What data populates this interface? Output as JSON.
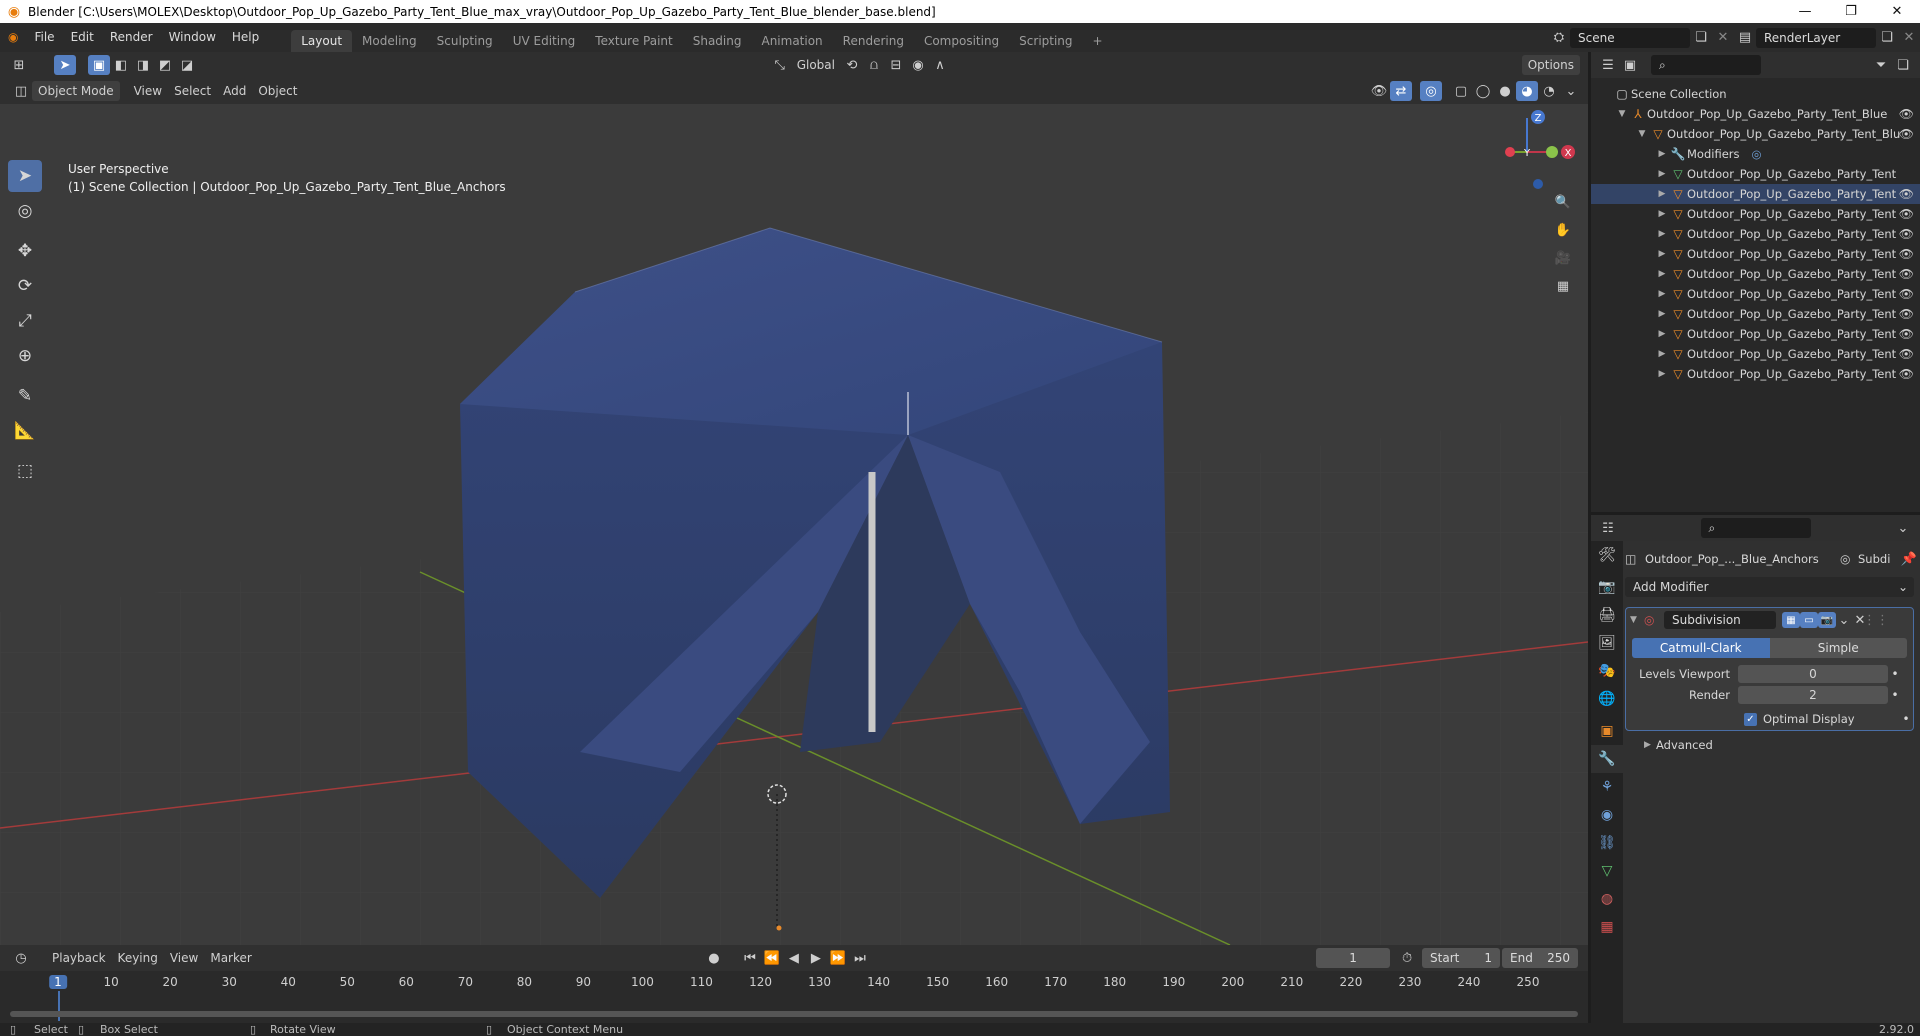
{
  "window": {
    "title": "Blender [C:\\Users\\MOLEX\\Desktop\\Outdoor_Pop_Up_Gazebo_Party_Tent_Blue_max_vray\\Outdoor_Pop_Up_Gazebo_Party_Tent_Blue_blender_base.blend]",
    "minimize": "—",
    "maximize": "❐",
    "close": "✕"
  },
  "menu": [
    "File",
    "Edit",
    "Render",
    "Window",
    "Help"
  ],
  "workspaces": [
    "Layout",
    "Modeling",
    "Sculpting",
    "UV Editing",
    "Texture Paint",
    "Shading",
    "Animation",
    "Rendering",
    "Compositing",
    "Scripting"
  ],
  "add_workspace": "+",
  "scene": {
    "name": "Scene",
    "view_layer": "RenderLayer"
  },
  "viewport": {
    "mode": "Object Mode",
    "menus": [
      "View",
      "Select",
      "Add",
      "Object"
    ],
    "transform_orientation": "Global",
    "options_label": "Options",
    "perspective_label": "User Perspective",
    "collection_label": "(1) Scene Collection | Outdoor_Pop_Up_Gazebo_Party_Tent_Blue_Anchors",
    "gizmo": {
      "x": "X",
      "y": "Y",
      "z": "Z"
    }
  },
  "outliner": {
    "root": "Scene Collection",
    "collection": "Outdoor_Pop_Up_Gazebo_Party_Tent_Blue",
    "object": "Outdoor_Pop_Up_Gazebo_Party_Tent_Blu",
    "modifiers": "Modifiers",
    "children": [
      "Outdoor_Pop_Up_Gazebo_Party_Tent",
      "Outdoor_Pop_Up_Gazebo_Party_Tent",
      "Outdoor_Pop_Up_Gazebo_Party_Tent",
      "Outdoor_Pop_Up_Gazebo_Party_Tent",
      "Outdoor_Pop_Up_Gazebo_Party_Tent",
      "Outdoor_Pop_Up_Gazebo_Party_Tent",
      "Outdoor_Pop_Up_Gazebo_Party_Tent",
      "Outdoor_Pop_Up_Gazebo_Party_Tent",
      "Outdoor_Pop_Up_Gazebo_Party_Tent",
      "Outdoor_Pop_Up_Gazebo_Party_Tent",
      "Outdoor_Pop_Up_Gazebo_Party_Tent"
    ]
  },
  "properties": {
    "object_name": "Outdoor_Pop_..._Blue_Anchors",
    "modifier_short": "Subdi",
    "add_modifier": "Add Modifier",
    "modifier": {
      "name": "Subdivision",
      "type_catmull": "Catmull-Clark",
      "type_simple": "Simple",
      "levels_viewport_label": "Levels Viewport",
      "levels_viewport": "0",
      "render_label": "Render",
      "render": "2",
      "optimal_display": "Optimal Display",
      "advanced": "Advanced"
    }
  },
  "timeline": {
    "menus": [
      "Playback",
      "Keying",
      "View",
      "Marker"
    ],
    "current_frame": "1",
    "start_label": "Start",
    "start": "1",
    "end_label": "End",
    "end": "250",
    "ticks": [
      "1",
      "10",
      "20",
      "30",
      "40",
      "50",
      "60",
      "70",
      "80",
      "90",
      "100",
      "110",
      "120",
      "130",
      "140",
      "150",
      "160",
      "170",
      "180",
      "190",
      "200",
      "210",
      "220",
      "230",
      "240",
      "250"
    ]
  },
  "statusbar": {
    "select": "Select",
    "box_select": "Box Select",
    "rotate_view": "Rotate View",
    "context_menu": "Object Context Menu",
    "version": "2.92.0"
  },
  "colors": {
    "accent": "#4772b3",
    "tent": "#2f3f66",
    "background": "#3b3b3b"
  }
}
